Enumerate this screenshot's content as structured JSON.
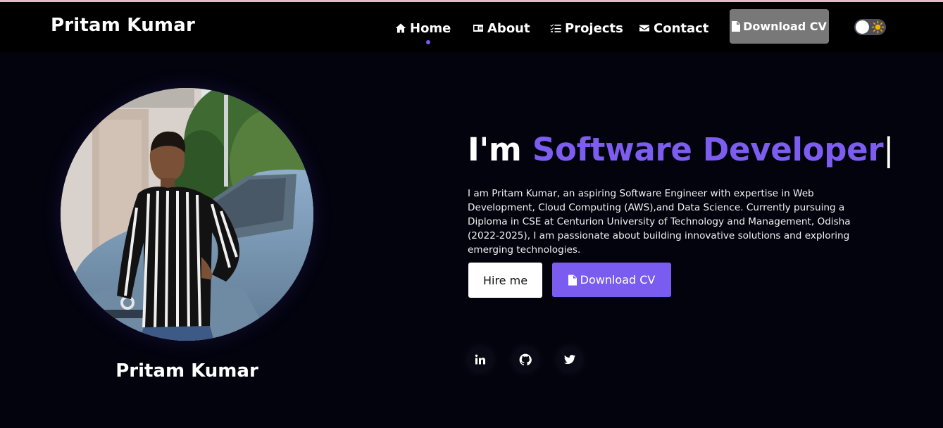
{
  "brand": "Pritam Kumar",
  "nav": {
    "items": [
      {
        "label": "Home",
        "icon": "home-icon"
      },
      {
        "label": "About",
        "icon": "id-card-icon"
      },
      {
        "label": "Projects",
        "icon": "list-check-icon"
      },
      {
        "label": "Contact",
        "icon": "envelope-icon"
      }
    ],
    "active": "Home",
    "cv_label": "Download CV",
    "theme_toggle_icon": "sun-icon"
  },
  "profile": {
    "name": "Pritam Kumar",
    "photo": "profile-photo"
  },
  "hero": {
    "prefix": "I'm ",
    "role": "Software Developer",
    "cursor": "|",
    "bio": "I am Pritam Kumar, an aspiring Software Engineer with expertise in Web Development, Cloud Computing (AWS),and Data Science. Currently pursuing a Diploma in CSE at Centurion University of Technology and Management, Odisha (2022-2025), I am passionate about building innovative solutions and exploring emerging technologies.",
    "hire_label": "Hire me",
    "cv_label": "Download CV"
  },
  "social": [
    {
      "name": "linkedin-icon"
    },
    {
      "name": "github-icon"
    },
    {
      "name": "twitter-icon"
    }
  ],
  "colors": {
    "accent": "#7b5cf0",
    "background": "#03030e",
    "navbar": "#000000",
    "nav_cv_button": "#787878"
  }
}
